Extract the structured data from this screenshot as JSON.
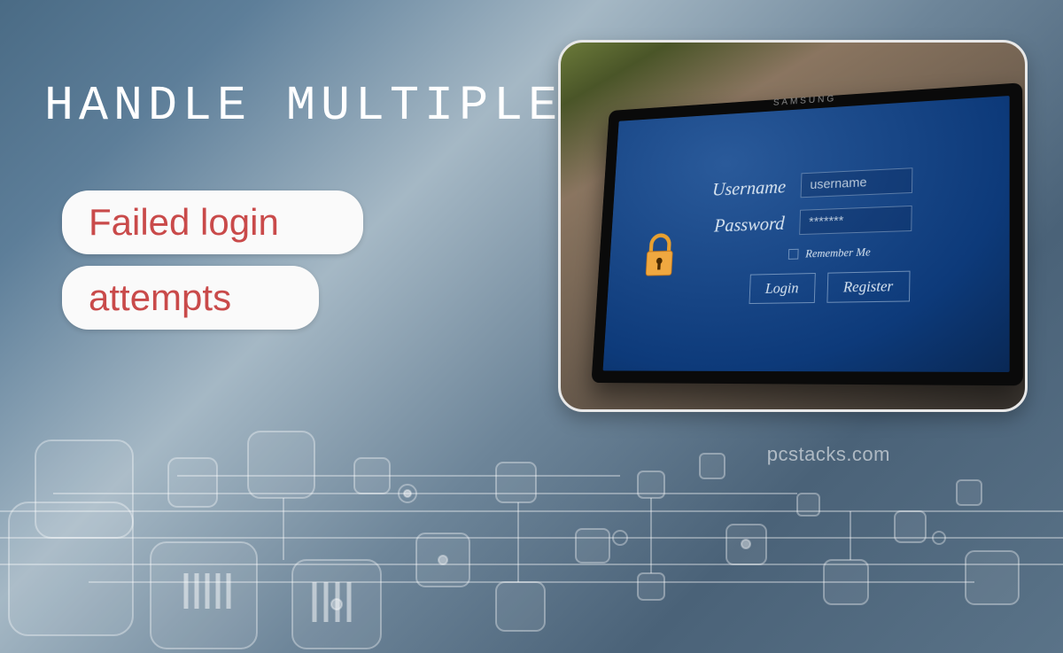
{
  "headline": "HANDLE MULTIPLE",
  "pill1": "Failed login",
  "pill2": "attempts",
  "tablet": {
    "brand": "SAMSUNG",
    "username_label": "Username",
    "username_value": "username",
    "password_label": "Password",
    "password_value": "*******",
    "remember_label": "Remember Me",
    "login_btn": "Login",
    "register_btn": "Register"
  },
  "watermark": "pcstacks.com"
}
